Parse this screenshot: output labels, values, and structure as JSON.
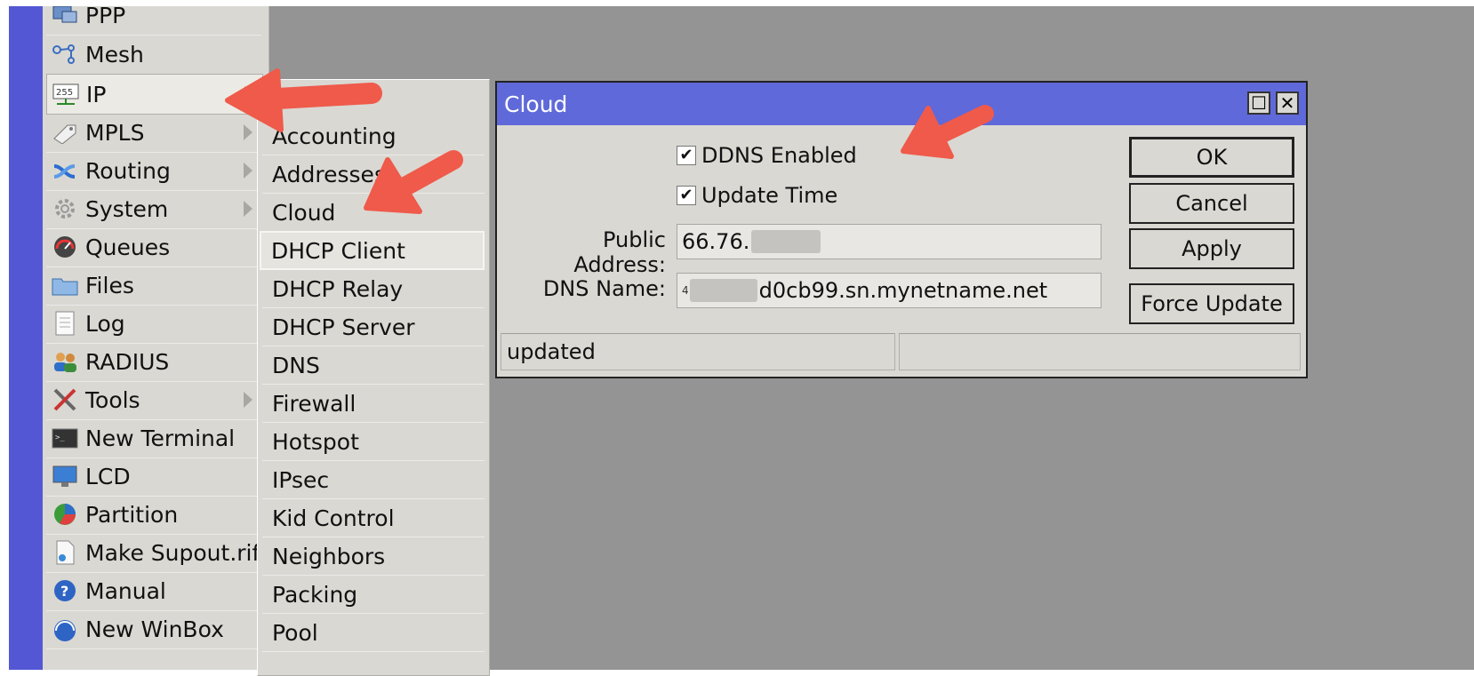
{
  "sidebar": {
    "items": [
      {
        "label": "PPP",
        "icon": "ppp-icon",
        "submenu": false
      },
      {
        "label": "Mesh",
        "icon": "mesh-icon",
        "submenu": false
      },
      {
        "label": "IP",
        "icon": "ip-icon",
        "submenu": true
      },
      {
        "label": "MPLS",
        "icon": "mpls-icon",
        "submenu": true
      },
      {
        "label": "Routing",
        "icon": "routing-icon",
        "submenu": true
      },
      {
        "label": "System",
        "icon": "system-gear-icon",
        "submenu": true
      },
      {
        "label": "Queues",
        "icon": "queues-gauge-icon",
        "submenu": false
      },
      {
        "label": "Files",
        "icon": "folder-icon",
        "submenu": false
      },
      {
        "label": "Log",
        "icon": "log-document-icon",
        "submenu": false
      },
      {
        "label": "RADIUS",
        "icon": "radius-users-icon",
        "submenu": false
      },
      {
        "label": "Tools",
        "icon": "tools-icon",
        "submenu": true
      },
      {
        "label": "New Terminal",
        "icon": "terminal-icon",
        "submenu": false
      },
      {
        "label": "LCD",
        "icon": "monitor-icon",
        "submenu": false
      },
      {
        "label": "Partition",
        "icon": "pie-chart-icon",
        "submenu": false
      },
      {
        "label": "Make Supout.rif",
        "icon": "file-icon",
        "submenu": false
      },
      {
        "label": "Manual",
        "icon": "help-icon",
        "submenu": false
      },
      {
        "label": "New WinBox",
        "icon": "winbox-icon",
        "submenu": false
      }
    ]
  },
  "ip_submenu": {
    "items": [
      "Accounting",
      "Addresses",
      "Cloud",
      "DHCP Client",
      "DHCP Relay",
      "DHCP Server",
      "DNS",
      "Firewall",
      "Hotspot",
      "IPsec",
      "Kid Control",
      "Neighbors",
      "Packing",
      "Pool"
    ]
  },
  "dialog": {
    "title": "Cloud",
    "ddns_enabled_label": "DDNS Enabled",
    "ddns_enabled_checked": true,
    "update_time_label": "Update Time",
    "update_time_checked": true,
    "public_address_label": "Public Address:",
    "public_address_value": "66.76.",
    "dns_name_label": "DNS Name:",
    "dns_name_prefix": "4",
    "dns_name_value": "d0cb99.sn.mynetname.net",
    "buttons": {
      "ok": "OK",
      "cancel": "Cancel",
      "apply": "Apply",
      "force_update": "Force Update"
    },
    "status": "updated",
    "check_mark": "✔",
    "maximize_symbol": "☐",
    "close_symbol": "✕"
  },
  "colors": {
    "titlebar": "#5f69d9",
    "annotation_arrow": "#ef5a4a",
    "left_strip": "#5357d4",
    "desktop": "#949494"
  }
}
